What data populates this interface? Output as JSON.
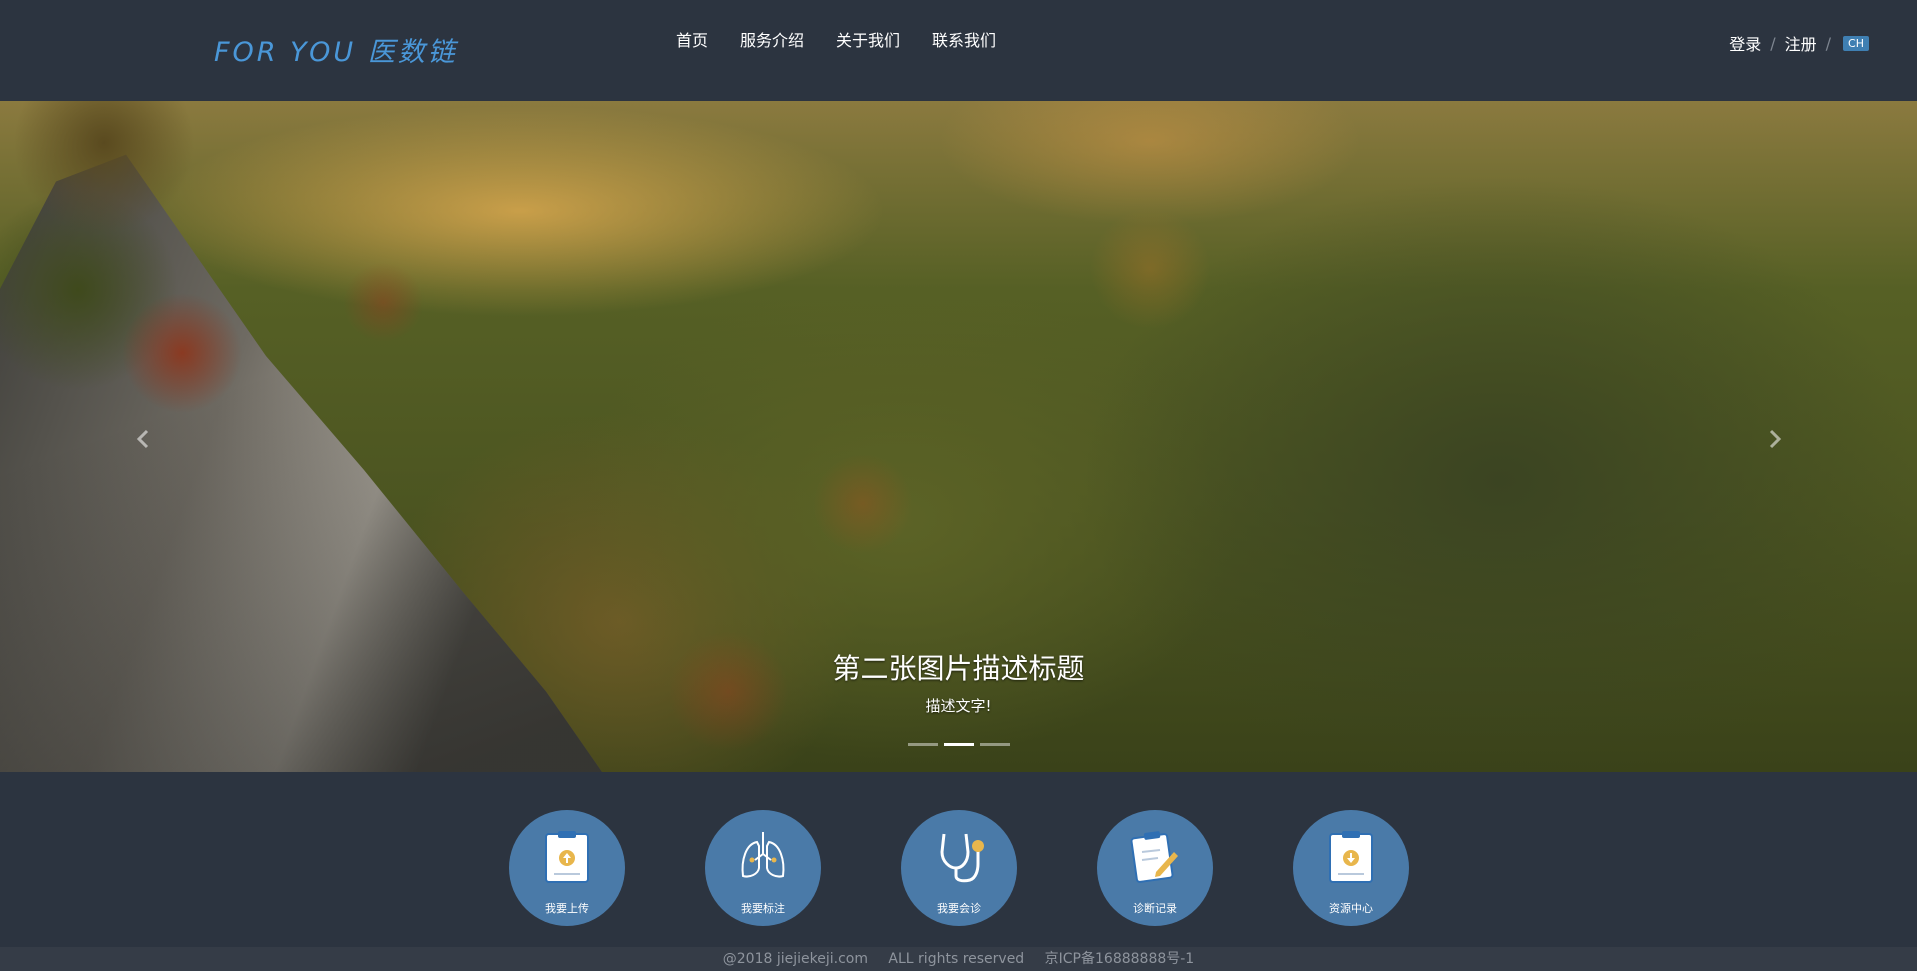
{
  "header": {
    "logo": "FOR YOU 医数链",
    "nav": [
      "首页",
      "服务介绍",
      "关于我们",
      "联系我们"
    ],
    "login": "登录",
    "separator": "/",
    "register": "注册",
    "language": "CH"
  },
  "carousel": {
    "title": "第二张图片描述标题",
    "subtitle": "描述文字!",
    "slide_count": 3,
    "active_slide": 2,
    "prev_icon": "chevron-left-icon",
    "next_icon": "chevron-right-icon"
  },
  "services": [
    {
      "label": "我要上传",
      "icon": "clipboard-upload-icon"
    },
    {
      "label": "我要标注",
      "icon": "lungs-icon"
    },
    {
      "label": "我要会诊",
      "icon": "stethoscope-icon"
    },
    {
      "label": "诊断记录",
      "icon": "clipboard-pen-icon"
    },
    {
      "label": "资源中心",
      "icon": "clipboard-download-icon"
    }
  ],
  "footer": {
    "copyright": "@2018 jiejiekeji.com",
    "rights": "ALL rights reserved",
    "icp": "京ICP备16888888号-1"
  },
  "colors": {
    "header_bg": "#2c3440",
    "logo": "#4a97d8",
    "service_circle": "#4a7aa8",
    "footer_bg": "#353c47"
  }
}
